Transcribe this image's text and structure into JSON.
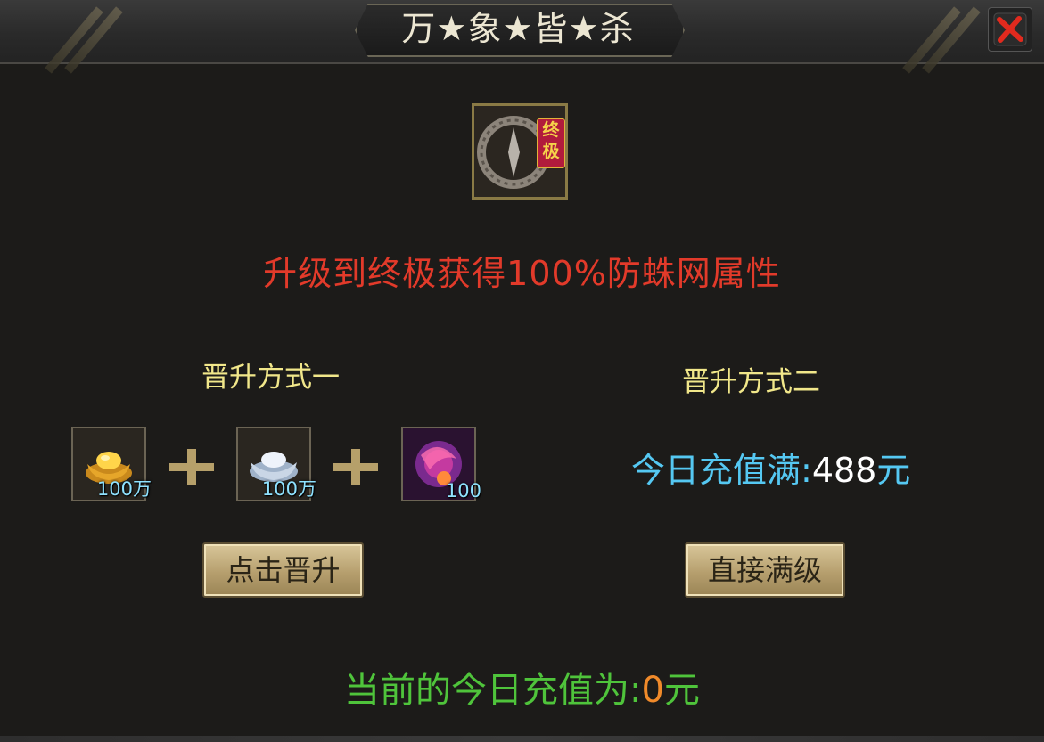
{
  "window": {
    "title": "万★象★皆★杀"
  },
  "item": {
    "badge": "终极",
    "badge_top": "终",
    "badge_bottom": "极"
  },
  "headline": "升级到终极获得100%防蛛网属性",
  "method_one": {
    "title": "晋升方式一",
    "costs": [
      {
        "icon": "gold-ingot-icon",
        "count": "100万"
      },
      {
        "icon": "silver-ingot-icon",
        "count": "100万"
      },
      {
        "icon": "magic-orb-icon",
        "count": "100"
      }
    ],
    "button_label": "点击晋升"
  },
  "method_two": {
    "title": "晋升方式二",
    "condition_label": "今日充值满:",
    "condition_value": "488",
    "condition_unit": "元",
    "button_label": "直接满级"
  },
  "footer": {
    "label": "当前的今日充值为:",
    "value": "0",
    "unit": "元"
  },
  "colors": {
    "headline": "#e23a2a",
    "method_title": "#f1e78a",
    "recharge": "#55c8f2",
    "current_label": "#4fc43b",
    "current_value": "#f08a2a"
  }
}
